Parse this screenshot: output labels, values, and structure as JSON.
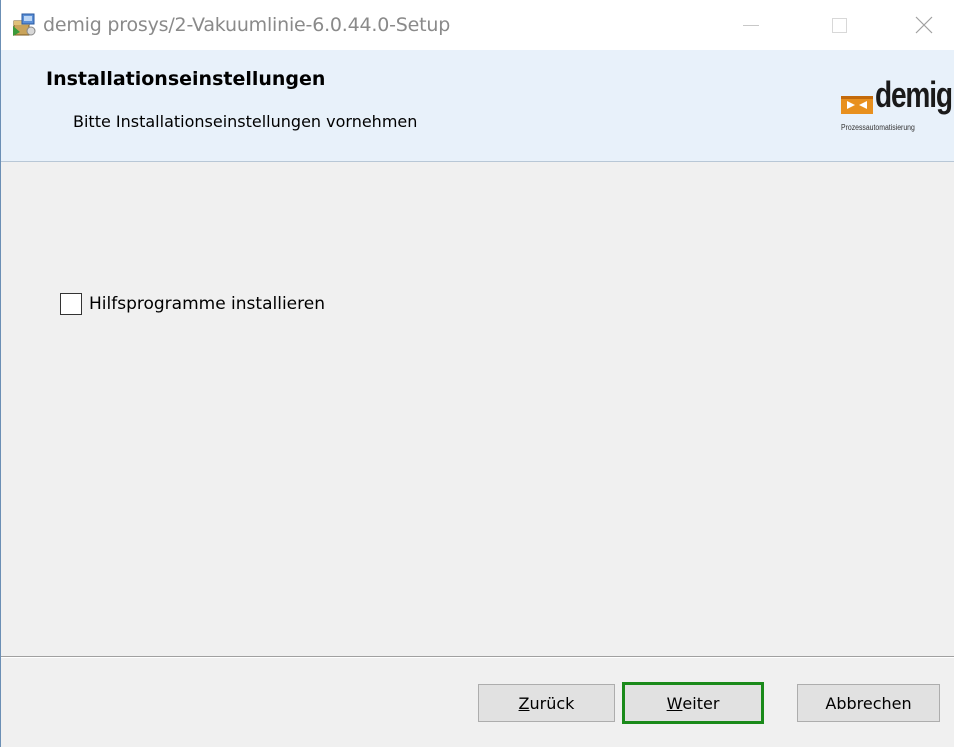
{
  "window": {
    "title": "demig prosys/2-Vakuumlinie-6.0.44.0-Setup"
  },
  "banner": {
    "title": "Installationseinstellungen",
    "subtitle": "Bitte Installationseinstellungen vornehmen",
    "logo": {
      "word": "demig",
      "tagline": "Prozessautomatisierung",
      "accent_color": "#e8901e"
    }
  },
  "content": {
    "checkbox": {
      "label": "Hilfsprogramme installieren",
      "checked": false
    }
  },
  "footer": {
    "back": {
      "mnemonic": "Z",
      "rest": "urück"
    },
    "next": {
      "mnemonic": "W",
      "rest": "eiter"
    },
    "cancel": {
      "label": "Abbrechen"
    },
    "focus_color": "#1a8a1a"
  },
  "icons": {
    "app": "installer-package-icon",
    "minimize": "minimize-icon",
    "maximize": "maximize-icon",
    "close": "close-icon"
  }
}
